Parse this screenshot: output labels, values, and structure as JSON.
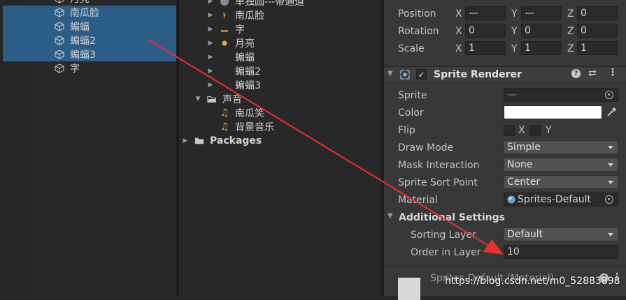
{
  "hierarchy": {
    "items": [
      {
        "label": "月亮",
        "selected": false
      },
      {
        "label": "南瓜脸",
        "selected": true
      },
      {
        "label": "蝙蝠",
        "selected": true
      },
      {
        "label": "蝙蝠2",
        "selected": true
      },
      {
        "label": "蝙蝠3",
        "selected": true
      },
      {
        "label": "字",
        "selected": false
      }
    ]
  },
  "project": {
    "items": [
      {
        "label": "单独圆---带通道",
        "icon": "sphere-icon"
      },
      {
        "label": "南瓜脸",
        "icon": "sprite-icon"
      },
      {
        "label": "字",
        "icon": "sprite-icon"
      },
      {
        "label": "月亮",
        "icon": "sprite-icon"
      },
      {
        "label": "蝙蝠",
        "icon": ""
      },
      {
        "label": "蝙蝠2",
        "icon": ""
      },
      {
        "label": "蝙蝠3",
        "icon": ""
      }
    ],
    "sound_folder": "声音",
    "sound_items": [
      {
        "label": "南瓜笑",
        "icon": "audio-icon"
      },
      {
        "label": "背景音乐",
        "icon": "audio-icon"
      }
    ],
    "packages": "Packages"
  },
  "inspector": {
    "transform": {
      "position": {
        "label": "Position",
        "x": "—",
        "y": "—",
        "z": "0"
      },
      "rotation": {
        "label": "Rotation",
        "x": "0",
        "y": "0",
        "z": "0"
      },
      "scale": {
        "label": "Scale",
        "x": "1",
        "y": "1",
        "z": "1"
      },
      "axis_x": "X",
      "axis_y": "Y",
      "axis_z": "Z"
    },
    "sprite_renderer": {
      "title": "Sprite Renderer",
      "enabled": "✓",
      "sprite": {
        "label": "Sprite",
        "value": "—"
      },
      "color": {
        "label": "Color",
        "value": "#ffffff"
      },
      "flip": {
        "label": "Flip",
        "x": "X",
        "y": "Y"
      },
      "draw_mode": {
        "label": "Draw Mode",
        "value": "Simple"
      },
      "mask_interaction": {
        "label": "Mask Interaction",
        "value": "None"
      },
      "sprite_sort_point": {
        "label": "Sprite Sort Point",
        "value": "Center"
      },
      "material": {
        "label": "Material",
        "value": "Sprites-Default"
      },
      "additional_settings": "Additional Settings",
      "sorting_layer": {
        "label": "Sorting Layer",
        "value": "Default"
      },
      "order_in_layer": {
        "label": "Order in Layer",
        "value": "10"
      }
    },
    "material_preview": {
      "title": "Sprites-Default (Material)"
    }
  },
  "watermark": "https://blog.csdn.net/m0_52883898",
  "colors": {
    "selection": "#2c5d87",
    "annotation_arrow": "#e8302e",
    "audio_icon": "#e8b33a"
  }
}
